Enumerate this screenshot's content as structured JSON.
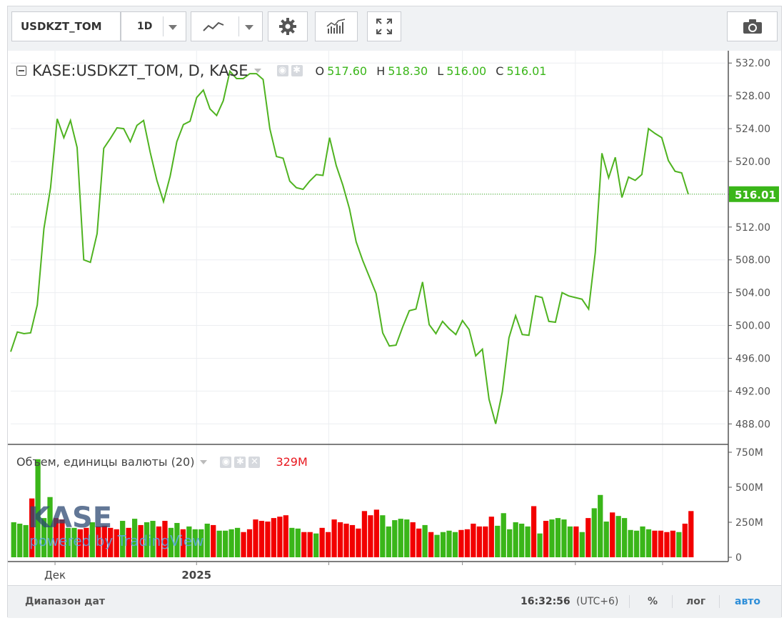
{
  "toolbar": {
    "symbol": "USDKZT_TOM",
    "interval": "1D",
    "icons": [
      "line-chart-icon",
      "chevron-down-icon",
      "gear-icon",
      "indicators-icon",
      "fullscreen-icon",
      "camera-icon"
    ]
  },
  "legend": {
    "title": "KASE:USDKZT_TOM, D, KASE",
    "o_label": "O",
    "o_value": "517.60",
    "h_label": "H",
    "h_value": "518.30",
    "l_label": "L",
    "l_value": "516.00",
    "c_label": "C",
    "c_value": "516.01"
  },
  "volume_legend": {
    "title": "Объем, единицы валюты (20)",
    "current": "329M"
  },
  "watermark": {
    "logo": "KASE",
    "tagline": "powered by TradingView"
  },
  "bottombar": {
    "date_range": "Диапазон дат",
    "time": "16:32:56",
    "tz": "(UTC+6)",
    "percent": "%",
    "log": "лог",
    "auto": "авто"
  },
  "colors": {
    "line": "#4fb320",
    "up": "#3ab619",
    "down": "#f20000",
    "last_price_bg": "#3ab619"
  },
  "chart_data": {
    "type": "line",
    "price": {
      "ylim": [
        485.5,
        533.5
      ],
      "ticks": [
        "532.00",
        "528.00",
        "524.00",
        "520.00",
        "516.00",
        "512.00",
        "508.00",
        "504.00",
        "500.00",
        "496.00",
        "492.00",
        "488.00"
      ],
      "last_price": "516.01",
      "values": [
        496.8,
        499.2,
        499.0,
        499.1,
        502.5,
        511.8,
        516.8,
        525.2,
        522.9,
        525.0,
        521.7,
        508.0,
        507.7,
        511.2,
        521.6,
        522.8,
        524.1,
        524.0,
        522.4,
        524.4,
        525.0,
        521.1,
        517.7,
        515.1,
        518.2,
        522.4,
        524.5,
        524.9,
        527.8,
        528.7,
        526.4,
        525.6,
        527.4,
        531.0,
        530.1,
        530.1,
        530.7,
        530.7,
        530.0,
        524.0,
        520.6,
        520.4,
        517.6,
        516.8,
        516.6,
        517.6,
        518.4,
        518.3,
        522.9,
        519.5,
        517.1,
        514.2,
        510.2,
        507.9,
        505.9,
        503.9,
        499.1,
        497.5,
        497.6,
        499.8,
        501.8,
        502.0,
        505.3,
        500.1,
        499.0,
        500.5,
        499.6,
        498.9,
        500.6,
        499.5,
        496.3,
        497.1,
        491.0,
        488.0,
        491.9,
        498.5,
        501.2,
        498.9,
        498.8,
        503.6,
        503.4,
        500.5,
        500.4,
        504.0,
        503.6,
        503.4,
        503.2,
        502.0,
        508.9,
        521.0,
        518.0,
        520.5,
        515.6,
        518.1,
        517.7,
        518.4,
        524.0,
        523.4,
        522.9,
        520.1,
        518.8,
        518.6,
        516.0
      ]
    },
    "volume": {
      "ticks": [
        "750M",
        "500M",
        "250M",
        "0"
      ],
      "ylim": [
        0,
        750
      ],
      "values": [
        250,
        240,
        230,
        420,
        700,
        280,
        430,
        280,
        270,
        210,
        210,
        200,
        210,
        250,
        220,
        225,
        210,
        200,
        260,
        210,
        275,
        230,
        250,
        260,
        220,
        260,
        210,
        245,
        200,
        220,
        200,
        200,
        240,
        230,
        190,
        190,
        200,
        210,
        180,
        200,
        270,
        260,
        255,
        280,
        290,
        300,
        210,
        205,
        180,
        180,
        170,
        210,
        180,
        270,
        250,
        240,
        230,
        205,
        330,
        300,
        340,
        300,
        220,
        265,
        275,
        270,
        250,
        205,
        230,
        180,
        160,
        180,
        190,
        180,
        195,
        200,
        240,
        220,
        220,
        290,
        225,
        315,
        200,
        250,
        240,
        220,
        365,
        170,
        260,
        270,
        280,
        270,
        220,
        220,
        180,
        280,
        350,
        445,
        255,
        320,
        295,
        280,
        195,
        190,
        220,
        200,
        190,
        190,
        180,
        190,
        180,
        240,
        330
      ],
      "directions": [
        "u",
        "u",
        "u",
        "d",
        "u",
        "u",
        "u",
        "d",
        "d",
        "u",
        "u",
        "d",
        "d",
        "u",
        "d",
        "d",
        "d",
        "d",
        "u",
        "d",
        "u",
        "d",
        "u",
        "u",
        "d",
        "d",
        "u",
        "u",
        "d",
        "u",
        "u",
        "u",
        "u",
        "d",
        "u",
        "u",
        "u",
        "u",
        "d",
        "d",
        "d",
        "d",
        "d",
        "d",
        "d",
        "d",
        "u",
        "u",
        "d",
        "d",
        "u",
        "d",
        "d",
        "d",
        "d",
        "d",
        "d",
        "d",
        "d",
        "d",
        "d",
        "u",
        "u",
        "u",
        "u",
        "u",
        "d",
        "d",
        "u",
        "d",
        "u",
        "u",
        "u",
        "u",
        "d",
        "d",
        "d",
        "d",
        "d",
        "d",
        "u",
        "u",
        "u",
        "u",
        "u",
        "u",
        "d",
        "u",
        "d",
        "u",
        "u",
        "u",
        "u",
        "d",
        "u",
        "d",
        "u",
        "u",
        "u",
        "d",
        "u",
        "u",
        "u",
        "u",
        "u",
        "u",
        "d",
        "d",
        "d",
        "d",
        "u",
        "d",
        "d"
      ]
    },
    "xaxis": {
      "labels": [
        {
          "text": "Дек",
          "pos": 0.062
        },
        {
          "text": "2025",
          "pos": 0.26
        },
        {
          "text": "",
          "pos": 0.445
        },
        {
          "text": "",
          "pos": 0.632
        },
        {
          "text": "",
          "pos": 0.79
        },
        {
          "text": "",
          "pos": 0.912
        }
      ]
    }
  }
}
